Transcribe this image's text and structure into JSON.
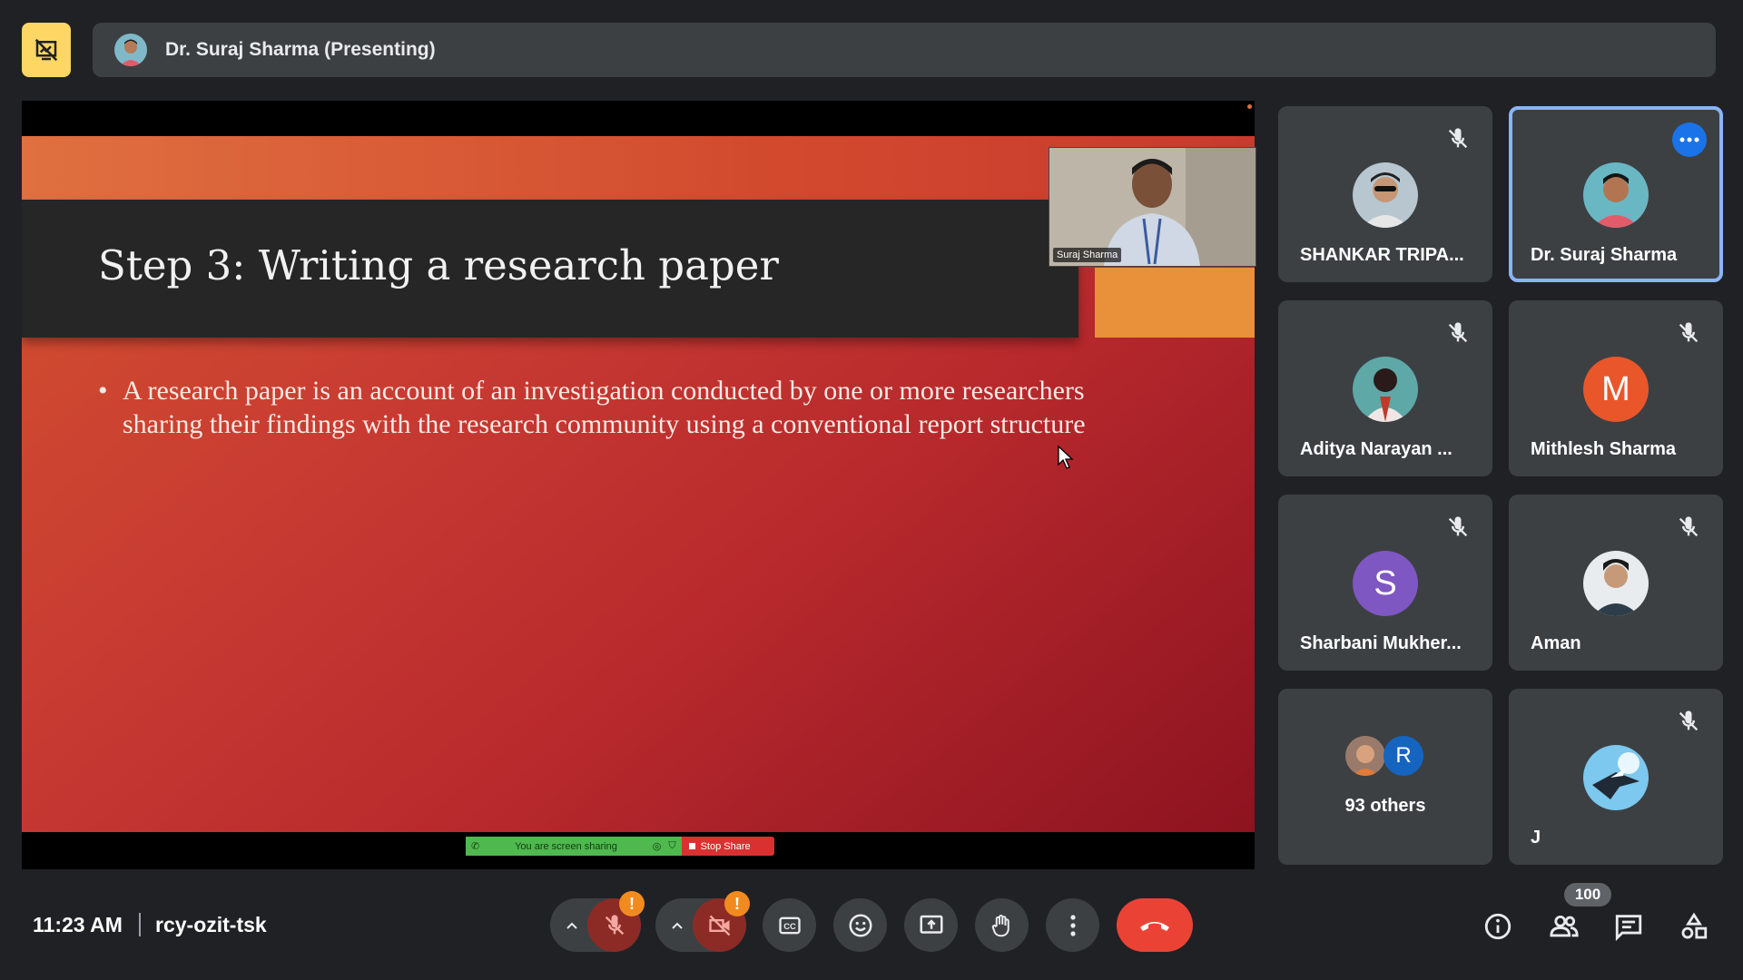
{
  "top_bar": {
    "presenter_label": "Dr. Suraj Sharma (Presenting)"
  },
  "slide": {
    "title": "Step 3: Writing a research paper",
    "bullet": "A research paper is an account of  an investigation conducted by one or more researchers sharing their findings with the research community using a conventional report structure",
    "self_view_name": "Suraj Sharma"
  },
  "share_bar": {
    "status_text": "You are screen sharing",
    "stop_label": "Stop Share"
  },
  "participants": [
    {
      "name": "SHANKAR TRIPA...",
      "muted": true
    },
    {
      "name": "Dr. Suraj Sharma",
      "muted": false,
      "active": true
    },
    {
      "name": "Aditya Narayan ...",
      "muted": true
    },
    {
      "name": "Mithlesh Sharma",
      "muted": true,
      "initial": "M",
      "color": "#e8562a"
    },
    {
      "name": "Sharbani Mukher...",
      "muted": true,
      "initial": "S",
      "color": "#7e57c2"
    },
    {
      "name": "Aman",
      "muted": true
    },
    {
      "name": "93 others",
      "initial": "R",
      "color": "#1565c0"
    },
    {
      "name": "J",
      "muted": true
    }
  ],
  "bottom_bar": {
    "time": "11:23 AM",
    "meeting_code": "rcy-ozit-tsk",
    "participant_count": "100",
    "mic_warning": "!",
    "cam_warning": "!"
  },
  "colors": {
    "accent": "#8ab4f8",
    "end_call": "#ea4335",
    "present_yellow": "#fdd663",
    "warning": "#f28b1f"
  }
}
